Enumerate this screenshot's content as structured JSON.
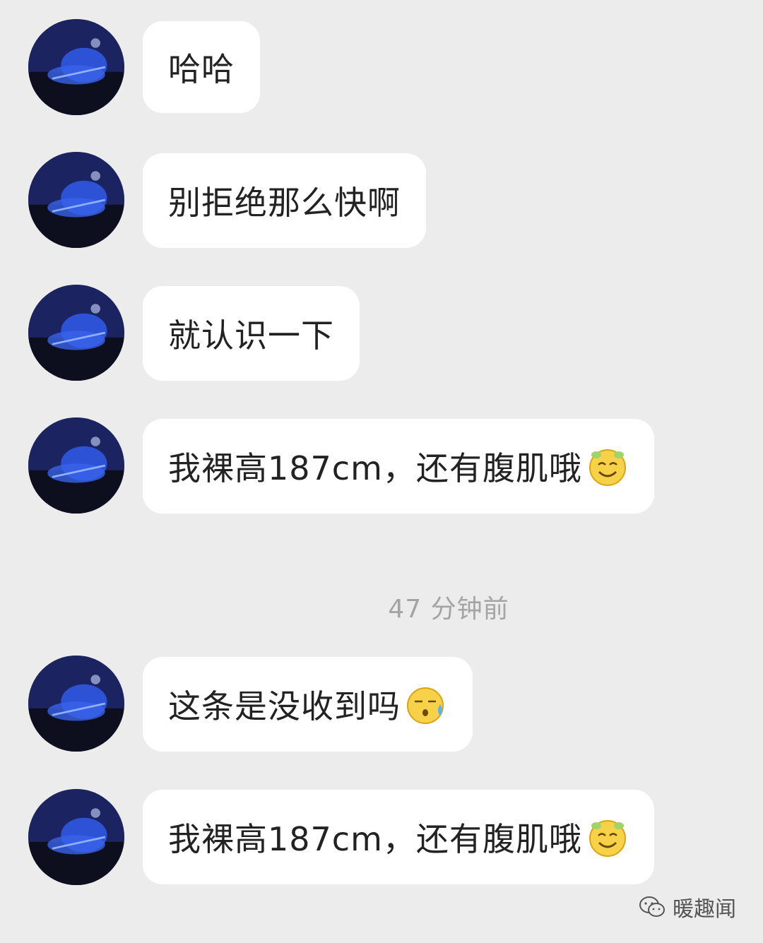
{
  "messages": [
    {
      "text": "哈哈",
      "emoji": null
    },
    {
      "text": "别拒绝那么快啊",
      "emoji": null
    },
    {
      "text": "就认识一下",
      "emoji": null
    },
    {
      "text": "我裸高187cm，还有腹肌哦",
      "emoji": "smug-smile-emoji"
    },
    {
      "text": "这条是没收到吗",
      "emoji": "awkward-sweat-emoji"
    },
    {
      "text": "我裸高187cm，还有腹肌哦",
      "emoji": "smug-smile-emoji"
    }
  ],
  "timestamp": "47 分钟前",
  "watermark": {
    "label": "暖趣闻",
    "icon": "wechat-icon"
  },
  "colors": {
    "background": "#ececec",
    "bubble": "#ffffff",
    "timestamp": "#a4a4a4",
    "avatar_accent": "#2f57d8"
  }
}
